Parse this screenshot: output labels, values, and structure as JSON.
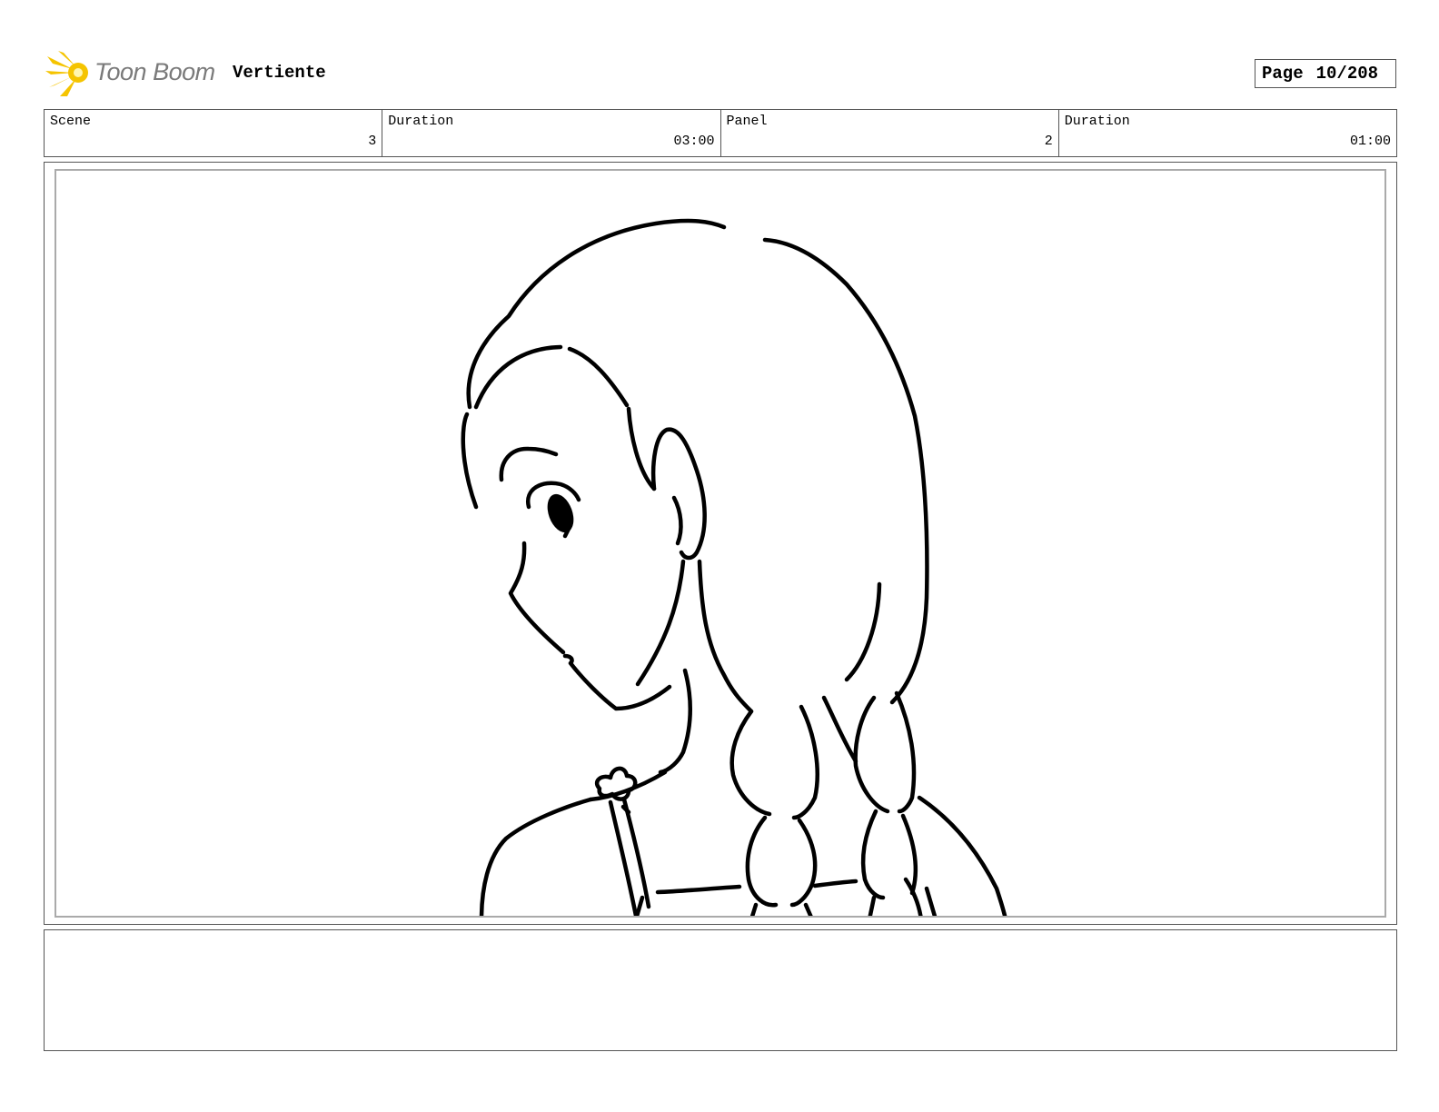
{
  "header": {
    "logo_text": "Toon Boom",
    "project_title": "Vertiente",
    "page_label": "Page",
    "page_number": "10/208"
  },
  "info_bar": {
    "scene": {
      "label": "Scene",
      "value": "3"
    },
    "scene_duration": {
      "label": "Duration",
      "value": "03:00"
    },
    "panel": {
      "label": "Panel",
      "value": "2"
    },
    "panel_duration": {
      "label": "Duration",
      "value": "01:00"
    }
  },
  "notes": {
    "text": ""
  },
  "colors": {
    "logo_accent": "#f5c400",
    "border": "#555555",
    "inner_border": "#aaaaaa"
  }
}
